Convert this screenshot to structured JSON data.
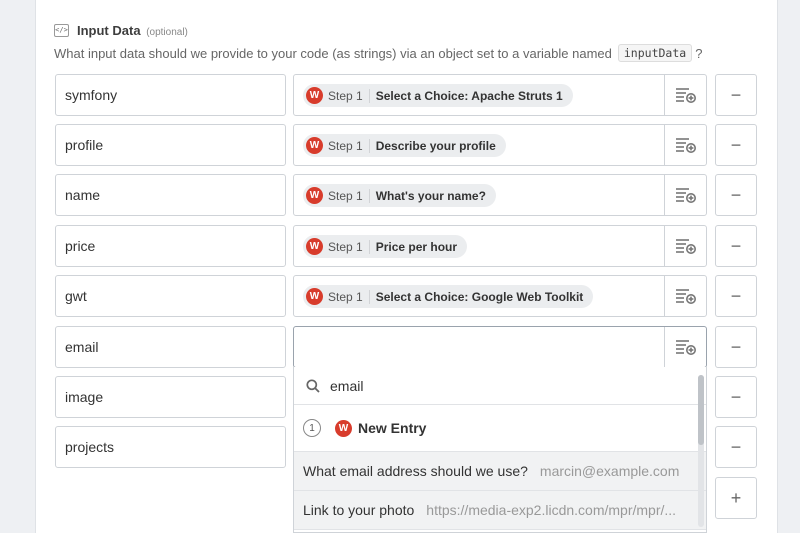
{
  "header": {
    "icon": "code-icon",
    "icon_glyph": "</>",
    "title": "Input Data",
    "optional": "(optional)",
    "description": "What input data should we provide to your code (as strings) via an object set to a variable named",
    "variable_name": "inputData",
    "description_suffix": "?"
  },
  "colors": {
    "app_icon": "#d83c2c",
    "pill_bg": "#ebedef"
  },
  "rows": [
    {
      "key": "symfony",
      "step": "Step 1",
      "field": "Select a Choice: Apache Struts 1"
    },
    {
      "key": "profile",
      "step": "Step 1",
      "field": "Describe your profile"
    },
    {
      "key": "name",
      "step": "Step 1",
      "field": "What's your name?"
    },
    {
      "key": "price",
      "step": "Step 1",
      "field": "Price per hour"
    },
    {
      "key": "gwt",
      "step": "Step 1",
      "field": "Select a Choice: Google Web Toolkit"
    },
    {
      "key": "email",
      "step": "",
      "field": ""
    },
    {
      "key": "image",
      "step": "",
      "field": ""
    },
    {
      "key": "projects",
      "step": "",
      "field": ""
    }
  ],
  "app_icon_letter": "W",
  "remove_label": "−",
  "add_label": "+",
  "dropdown": {
    "search_value": "email",
    "step_number": "1",
    "step_name": "New Entry",
    "items": [
      {
        "label": "What email address should we use?",
        "value": "marcin@example.com"
      },
      {
        "label": "Link to your photo",
        "value": "https://media-exp2.licdn.com/mpr/mpr/..."
      }
    ]
  }
}
